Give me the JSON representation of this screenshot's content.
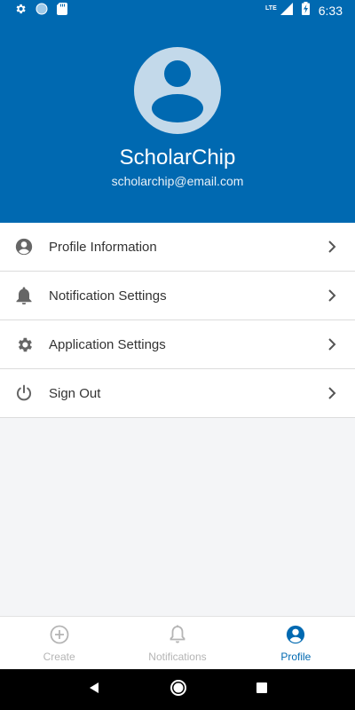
{
  "status_bar": {
    "time": "6:33",
    "network": "LTE",
    "icons": [
      "settings-gear-icon",
      "sync-circle-icon",
      "sd-card-icon",
      "signal-icon",
      "battery-charging-icon"
    ]
  },
  "profile": {
    "name": "ScholarChip",
    "email": "scholarchip@email.com",
    "avatar_icon": "account-avatar-icon"
  },
  "menu": {
    "items": [
      {
        "label": "Profile Information",
        "icon": "account-circle-icon"
      },
      {
        "label": "Notification Settings",
        "icon": "bell-icon"
      },
      {
        "label": "Application Settings",
        "icon": "gear-icon"
      },
      {
        "label": "Sign Out",
        "icon": "power-icon"
      }
    ]
  },
  "bottom_nav": {
    "tabs": [
      {
        "label": "Create",
        "icon": "plus-circle-icon",
        "active": false
      },
      {
        "label": "Notifications",
        "icon": "bell-outline-icon",
        "active": false
      },
      {
        "label": "Profile",
        "icon": "account-circle-icon",
        "active": true
      }
    ]
  },
  "colors": {
    "primary": "#0069b1",
    "background": "#f4f5f7",
    "inactive": "#b5b5b5",
    "text": "#333333",
    "icon": "#666666"
  }
}
